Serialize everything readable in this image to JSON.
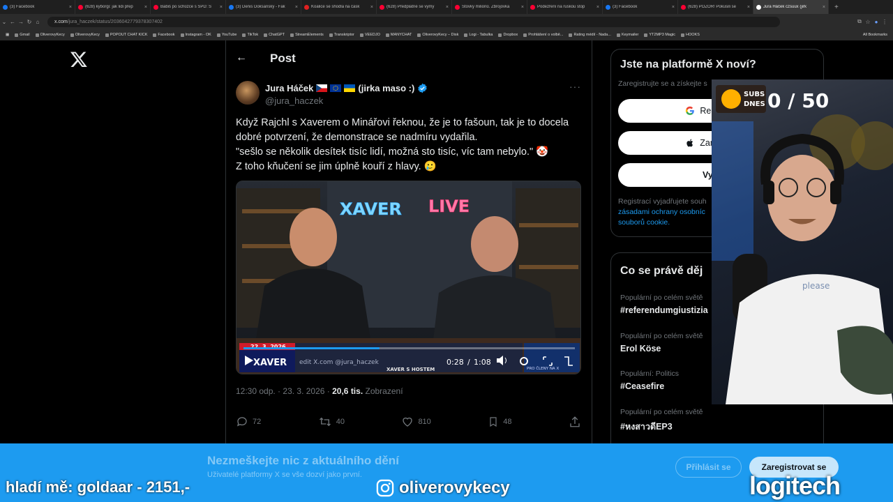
{
  "browser": {
    "tabs": [
      {
        "label": "(3) Facebook",
        "color": "#1877f2"
      },
      {
        "label": "(628) kyborgi: jak lidi přep",
        "color": "#ff0033"
      },
      {
        "label": "Babiš po schůzce s SPD: S",
        "color": "#ff0033"
      },
      {
        "label": "(3) Denis Doksanský - Fak",
        "color": "#1877f2"
      },
      {
        "label": "Koalice se shodla na čásk",
        "color": "#e02020"
      },
      {
        "label": "(628) Předplatné se vymy",
        "color": "#ff0033"
      },
      {
        "label": "Stovky milionů. Zbrojovka",
        "color": "#ff0033"
      },
      {
        "label": "Podezření na ruskou stop",
        "color": "#ff0033"
      },
      {
        "label": "(3) Facebook",
        "color": "#1877f2"
      },
      {
        "label": "(628) POZOR! Pokusili se",
        "color": "#ff0033"
      },
      {
        "label": "Jura Háček czsuux (jirk",
        "color": "#ffffff",
        "active": true
      }
    ],
    "url_host": "x.com",
    "url_path": "/jura_haczek/status/2036042779378307402",
    "bookmarks": [
      "Gmail",
      "OliverovyKecy",
      "OliverovyKecy",
      "POPOUT CHAT KICK",
      "Facebook",
      "Instagram - OK",
      "YouTube",
      "TikTok",
      "ChatGPT",
      "StreamElements",
      "Transkriptor",
      "VEEDJO",
      "MANYCHAT",
      "OliverovyKecy – Disk",
      "Logi - Tabulka",
      "Dropbox",
      "Prohlášení o volbě...",
      "Rating médií - Nada...",
      "Keymailer",
      "YT2MP3 Magic",
      "HOOKS"
    ],
    "all_bookmarks": "All Bookmarks"
  },
  "post": {
    "header_title": "Post",
    "author_name": "Jura Háček",
    "author_suffix": "(jirka maso :)",
    "handle": "@jura_haczek",
    "lines": [
      "Když Rajchl s Xaverem o Minářovi řeknou, že je to fašoun, tak je to docela",
      "dobré potvrzení, že demonstrace se nadmíru vydařila.",
      "\"sešlo se několik desítek tisíc lidí, možná sto tisíc, víc tam nebylo.\" 🤡",
      "Z toho kňučení se jim úplně kouří z hlavy. 🥲"
    ],
    "time": "12:30 odp.",
    "date": "23. 3. 2026",
    "views_count": "20,6 tis.",
    "views_label": "Zobrazení",
    "replies": "72",
    "reposts": "40",
    "likes": "810",
    "bookmarks": "48"
  },
  "video": {
    "neon_left": "XAVER",
    "neon_right": "LIVE",
    "ticker_date": "22. 3. 2026",
    "ticker_brand": "XAVER",
    "watermark": "edit X.com @jura_haczek",
    "subtitle": "XAVER S HOSTEM",
    "inset_label": "PRO ČLENY NA X",
    "current_time": "0:28",
    "duration": "1:08",
    "progress_fraction": 0.41
  },
  "sidebar": {
    "signup_title": "Jste na platformě X noví?",
    "signup_sub": "Zaregistrujte se a získejte s",
    "google_btn": "Registrace p",
    "apple_btn": "Zaregistrova",
    "create_btn": "Vytvoři",
    "legal_1": "Registrací vyjadřujete souh",
    "legal_2": "zásadami ochrany osobníc",
    "legal_3": "souborů cookie.",
    "trends_title": "Co se právě děj",
    "trends": [
      {
        "context": "Populární po celém světě",
        "name": "#referendumgiustizia"
      },
      {
        "context": "Populární po celém světě",
        "name": "Erol Köse"
      },
      {
        "context": "Populární: Politics",
        "name": "#Ceasefire"
      },
      {
        "context": "Populární po celém světě",
        "name": "#หงสาวดีEP3"
      }
    ]
  },
  "overlay": {
    "subs_label_1": "SUBS",
    "subs_label_2": "DNES",
    "subs_counter": "0 / 50",
    "shirt_text": "please",
    "ticker_text": "hladí mě: goldaar - 2151,-",
    "instagram": "oliverovykecy",
    "sponsor": "logitech"
  },
  "banner": {
    "title": "Nezmeškejte nic z aktuálního dění",
    "subtitle": "Uživatelé platformy X se vše dozví jako první.",
    "login": "Přihlásit se",
    "signup": "Zaregistrovat se"
  },
  "colors": {
    "x_blue": "#1d9bf0",
    "verified": "#1d9bf0",
    "background": "#000000",
    "muted": "#71767b"
  }
}
